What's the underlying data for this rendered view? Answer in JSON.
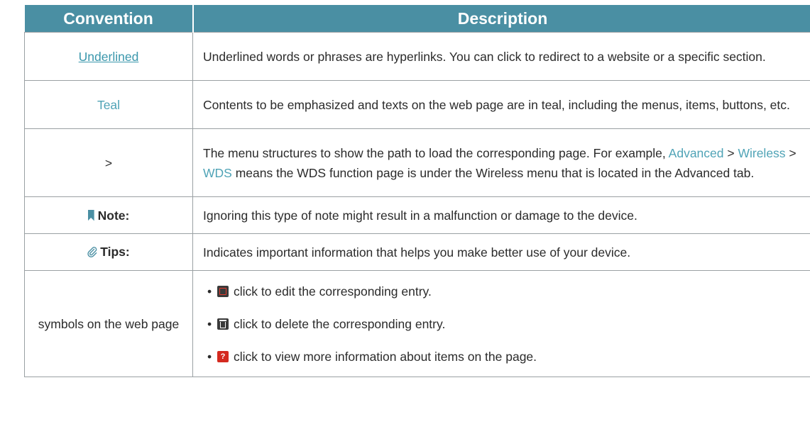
{
  "header": {
    "col1": "Convention",
    "col2": "Description"
  },
  "rows": {
    "underlined": {
      "convention": "Underlined",
      "description": "Underlined words or phrases are hyperlinks. You can click to redirect to a website or a specific section."
    },
    "teal": {
      "convention": "Teal",
      "description": "Contents to be emphasized and texts on the web page are in teal, including the menus, items, buttons, etc."
    },
    "arrow": {
      "convention": ">",
      "desc_pre": "The menu structures to show the path to load the corresponding page. For example, ",
      "path1": "Advanced",
      "sep1": " > ",
      "path2": "Wireless",
      "sep2": " > ",
      "path3": "WDS",
      "desc_post": " means the WDS function page is under the Wireless menu that is located in the Advanced tab."
    },
    "note": {
      "convention": "Note:",
      "icon": "bookmark-icon",
      "description": "Ignoring this type of note might result in a malfunction or damage to the device."
    },
    "tips": {
      "convention": "Tips:",
      "icon": "paperclip-icon",
      "description": "Indicates important information that helps you make better use of your device."
    },
    "symbols": {
      "convention": "symbols on the web page",
      "items": [
        {
          "icon": "edit-icon",
          "text": "click to edit the corresponding entry."
        },
        {
          "icon": "trash-icon",
          "text": "click to delete the corresponding entry."
        },
        {
          "icon": "help-icon",
          "text": "click to view more information about items on the page."
        }
      ]
    }
  },
  "colors": {
    "header_bg": "#4a8fa3",
    "teal_text": "#4fa3b6",
    "border": "#9aa0a3"
  }
}
